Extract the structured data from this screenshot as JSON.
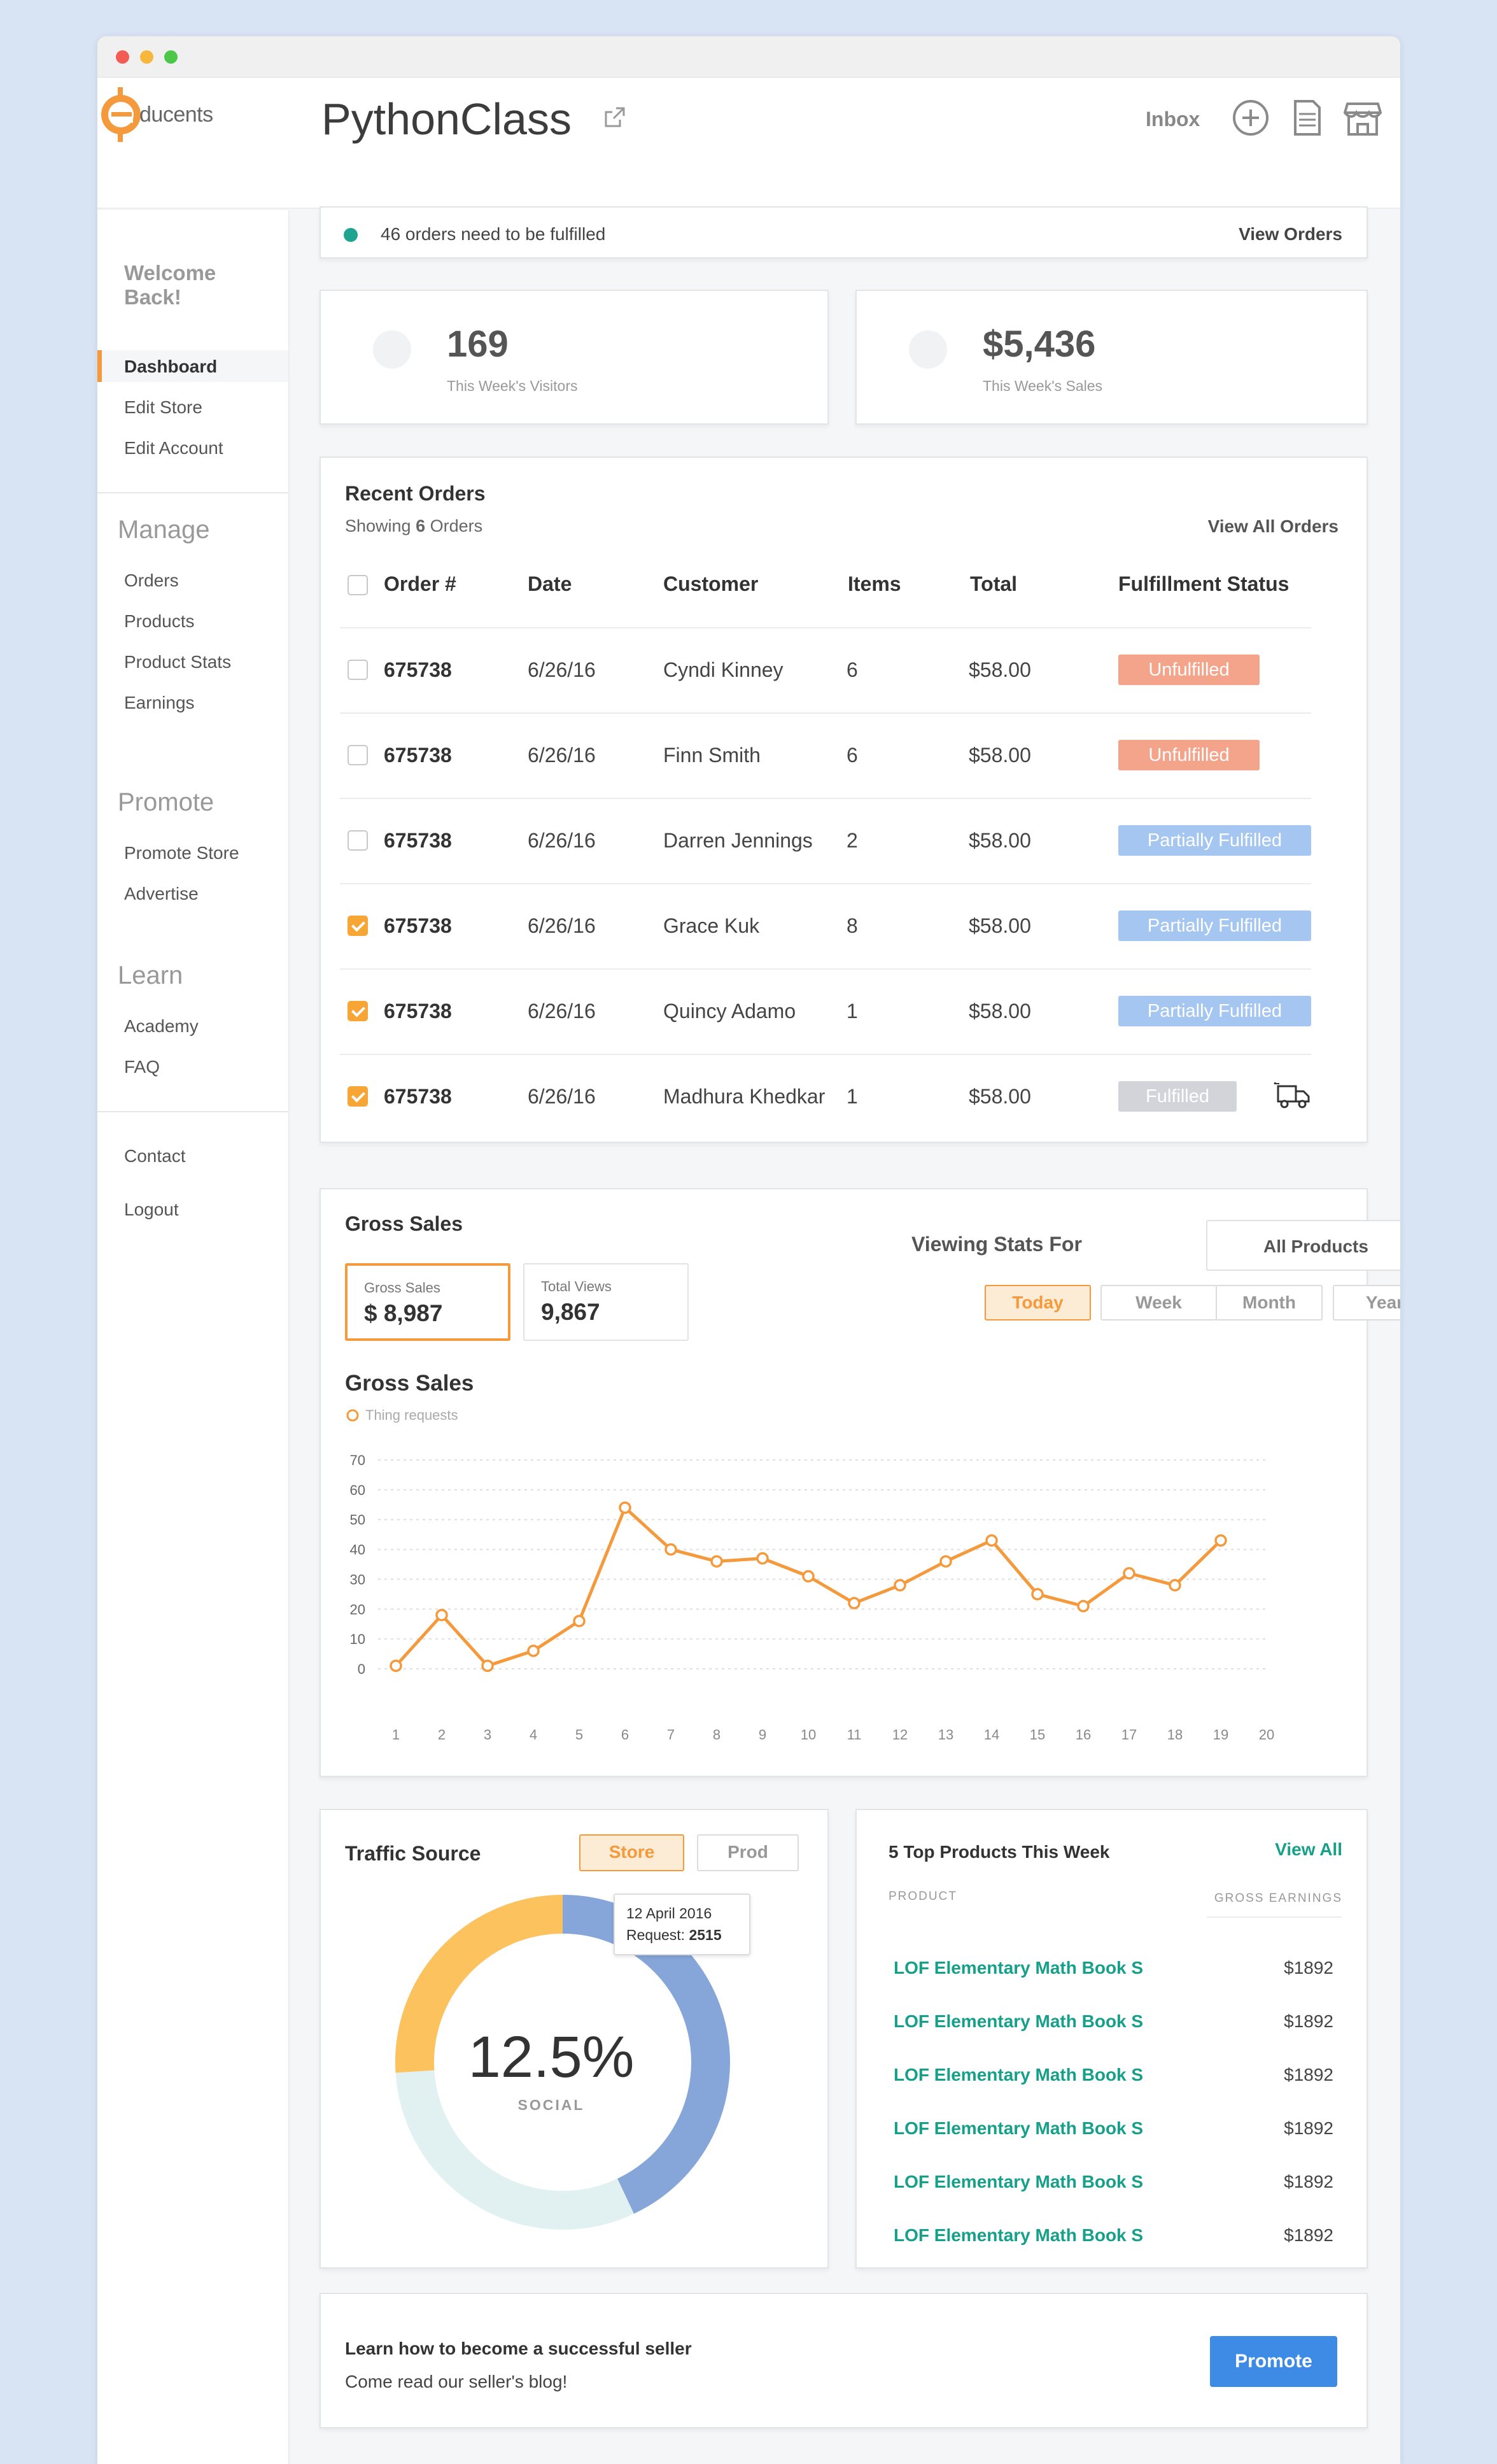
{
  "brand": {
    "logo_text": "ducents",
    "logo_letter": "e",
    "accent": "#f59a3c",
    "teal": "#16a08a",
    "blue": "#3d8be5"
  },
  "header": {
    "title": "PythonClass",
    "inbox_label": "Inbox",
    "icons": [
      "external-link-icon",
      "plus-circle-icon",
      "document-icon",
      "store-icon"
    ]
  },
  "sidebar": {
    "welcome": "Welcome Back!",
    "top_items": [
      "Dashboard",
      "Edit Store",
      "Edit Account"
    ],
    "manage": {
      "title": "Manage",
      "items": [
        "Orders",
        "Products",
        "Product Stats",
        "Earnings"
      ]
    },
    "promote": {
      "title": "Promote",
      "items": [
        "Promote Store",
        "Advertise"
      ]
    },
    "learn": {
      "title": "Learn",
      "items": [
        "Academy",
        "FAQ"
      ]
    },
    "bottom_items": [
      "Contact",
      "Logout"
    ]
  },
  "notice": {
    "text": "46 orders need to be fulfilled",
    "link": "View Orders"
  },
  "stats": [
    {
      "value": "169",
      "label": "This Week's Visitors"
    },
    {
      "value": "$5,436",
      "label": "This Week's Sales"
    }
  ],
  "recent_orders": {
    "title": "Recent Orders",
    "showing_prefix": "Showing ",
    "showing_count": "6",
    "showing_suffix": " Orders",
    "view_all": "View All Orders",
    "columns": [
      "Order #",
      "Date",
      "Customer",
      "Items",
      "Total",
      "Fulfillment Status"
    ],
    "rows": [
      {
        "checked": false,
        "order": "675738",
        "date": "6/26/16",
        "customer": "Cyndi Kinney",
        "items": "6",
        "total": "$58.00",
        "status": "Unfulfilled",
        "status_color": "#f4a48a"
      },
      {
        "checked": false,
        "order": "675738",
        "date": "6/26/16",
        "customer": "Finn Smith",
        "items": "6",
        "total": "$58.00",
        "status": "Unfulfilled",
        "status_color": "#f4a48a"
      },
      {
        "checked": false,
        "order": "675738",
        "date": "6/26/16",
        "customer": "Darren Jennings",
        "items": "2",
        "total": "$58.00",
        "status": "Partially Fulfilled",
        "status_color": "#a6c6f2"
      },
      {
        "checked": true,
        "order": "675738",
        "date": "6/26/16",
        "customer": "Grace Kuk",
        "items": "8",
        "total": "$58.00",
        "status": "Partially Fulfilled",
        "status_color": "#a6c6f2"
      },
      {
        "checked": true,
        "order": "675738",
        "date": "6/26/16",
        "customer": "Quincy Adamo",
        "items": "1",
        "total": "$58.00",
        "status": "Partially Fulfilled",
        "status_color": "#a6c6f2"
      },
      {
        "checked": true,
        "order": "675738",
        "date": "6/26/16",
        "customer": "Madhura Khedkar",
        "items": "1",
        "total": "$58.00",
        "status": "Fulfilled",
        "status_color": "#d3d4d9"
      }
    ]
  },
  "gross_sales": {
    "title": "Gross Sales",
    "boxes": [
      {
        "label": "Gross Sales",
        "value": "$ 8,987"
      },
      {
        "label": "Total Views",
        "value": "9,867"
      }
    ],
    "viewing_label": "Viewing Stats For",
    "select_value": "All Products",
    "periods": [
      "Today",
      "Week",
      "Month",
      "Year"
    ],
    "active_period": "Today"
  },
  "chart_data": {
    "type": "line",
    "title": "Gross Sales",
    "legend": "Thing requests",
    "x": [
      1,
      2,
      3,
      4,
      5,
      6,
      7,
      8,
      9,
      10,
      11,
      12,
      13,
      14,
      15,
      16,
      17,
      18,
      19
    ],
    "x_ticks": [
      1,
      2,
      3,
      4,
      5,
      6,
      7,
      8,
      9,
      10,
      11,
      12,
      13,
      14,
      15,
      16,
      17,
      18,
      19,
      20
    ],
    "y_ticks": [
      0,
      10,
      20,
      30,
      40,
      50,
      60,
      70
    ],
    "ylim": [
      0,
      70
    ],
    "series": [
      {
        "values": [
          1,
          18,
          1,
          6,
          16,
          54,
          40,
          36,
          37,
          31,
          22,
          28,
          36,
          43,
          25,
          21,
          32,
          28,
          43
        ]
      }
    ],
    "color": "#f59a3c",
    "grid": true
  },
  "traffic": {
    "title": "Traffic Source",
    "tabs": [
      "Store",
      "Prod"
    ],
    "active_tab": "Store",
    "center_value": "12.5%",
    "center_label": "SOCIAL",
    "tooltip_date": "12 April 2016",
    "tooltip_prefix": "Request: ",
    "tooltip_value": "2515",
    "segments": [
      {
        "fraction": 0.43,
        "color": "#86a5d9"
      },
      {
        "fraction": 0.31,
        "color": "#e1f1f1"
      },
      {
        "fraction": 0.26,
        "color": "#fbc25e"
      }
    ]
  },
  "top_products": {
    "title": "5 Top Products This Week",
    "view_all": "View All",
    "col_product": "PRODUCT",
    "col_earnings": "GROSS EARNINGS",
    "rows": [
      {
        "name": "LOF Elementary Math Book S",
        "value": "$1892"
      },
      {
        "name": "LOF Elementary Math Book S",
        "value": "$1892"
      },
      {
        "name": "LOF Elementary Math Book S",
        "value": "$1892"
      },
      {
        "name": "LOF Elementary Math Book S",
        "value": "$1892"
      },
      {
        "name": "LOF Elementary Math Book S",
        "value": "$1892"
      },
      {
        "name": "LOF Elementary Math Book S",
        "value": "$1892"
      }
    ]
  },
  "promo": {
    "title": "Learn how to become a successful seller",
    "subtitle": "Come read our seller's blog!",
    "button": "Promote"
  }
}
